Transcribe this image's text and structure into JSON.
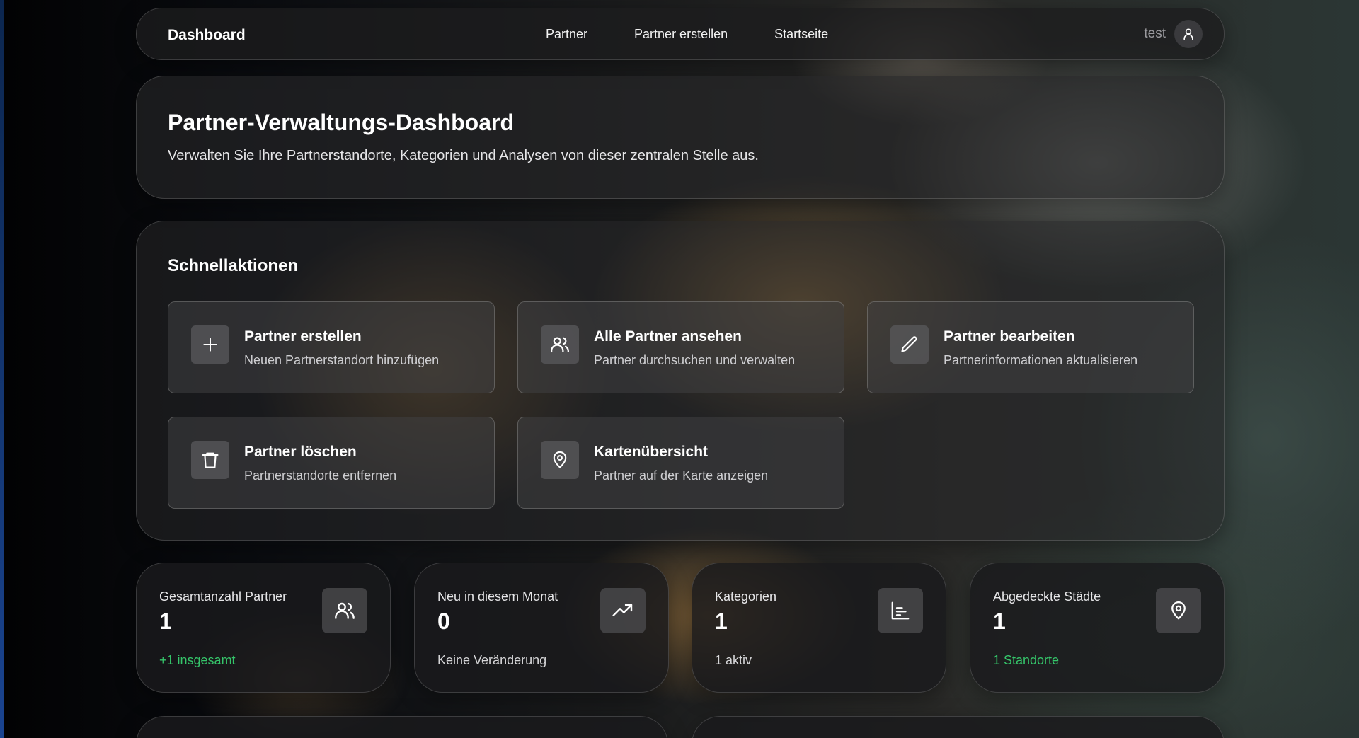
{
  "navbar": {
    "brand": "Dashboard",
    "links": [
      "Partner",
      "Partner erstellen",
      "Startseite"
    ],
    "user": "test",
    "user_icon": "user-icon"
  },
  "hero": {
    "title": "Partner-Verwaltungs-Dashboard",
    "subtitle": "Verwalten Sie Ihre Partnerstandorte, Kategorien und Analysen von dieser zentralen Stelle aus."
  },
  "quick_actions": {
    "title": "Schnellaktionen",
    "items": [
      {
        "title": "Partner erstellen",
        "desc": "Neuen Partnerstandort hinzufügen",
        "icon": "plus-icon"
      },
      {
        "title": "Alle Partner ansehen",
        "desc": "Partner durchsuchen und verwalten",
        "icon": "users-icon"
      },
      {
        "title": "Partner bearbeiten",
        "desc": "Partnerinformationen aktualisieren",
        "icon": "pencil-icon"
      },
      {
        "title": "Partner löschen",
        "desc": "Partnerstandorte entfernen",
        "icon": "trash-icon"
      },
      {
        "title": "Kartenübersicht",
        "desc": "Partner auf der Karte anzeigen",
        "icon": "map-pin-icon"
      }
    ]
  },
  "stats": [
    {
      "label": "Gesamtanzahl Partner",
      "value": "1",
      "foot": "+1 insgesamt",
      "foot_color": "#35c56a",
      "icon": "users-icon"
    },
    {
      "label": "Neu in diesem Monat",
      "value": "0",
      "foot": "Keine Veränderung",
      "foot_color": "#d6d6d8",
      "icon": "trending-up-icon"
    },
    {
      "label": "Kategorien",
      "value": "1",
      "foot": "1 aktiv",
      "foot_color": "#d6d6d8",
      "icon": "bar-chart-icon"
    },
    {
      "label": "Abgedeckte Städte",
      "value": "1",
      "foot": "1 Standorte",
      "foot_color": "#35c56a",
      "icon": "map-pin-icon"
    }
  ],
  "colors": {
    "accent_green": "#35c56a",
    "card_bg": "#262628",
    "text_muted": "#9b9b9f"
  }
}
